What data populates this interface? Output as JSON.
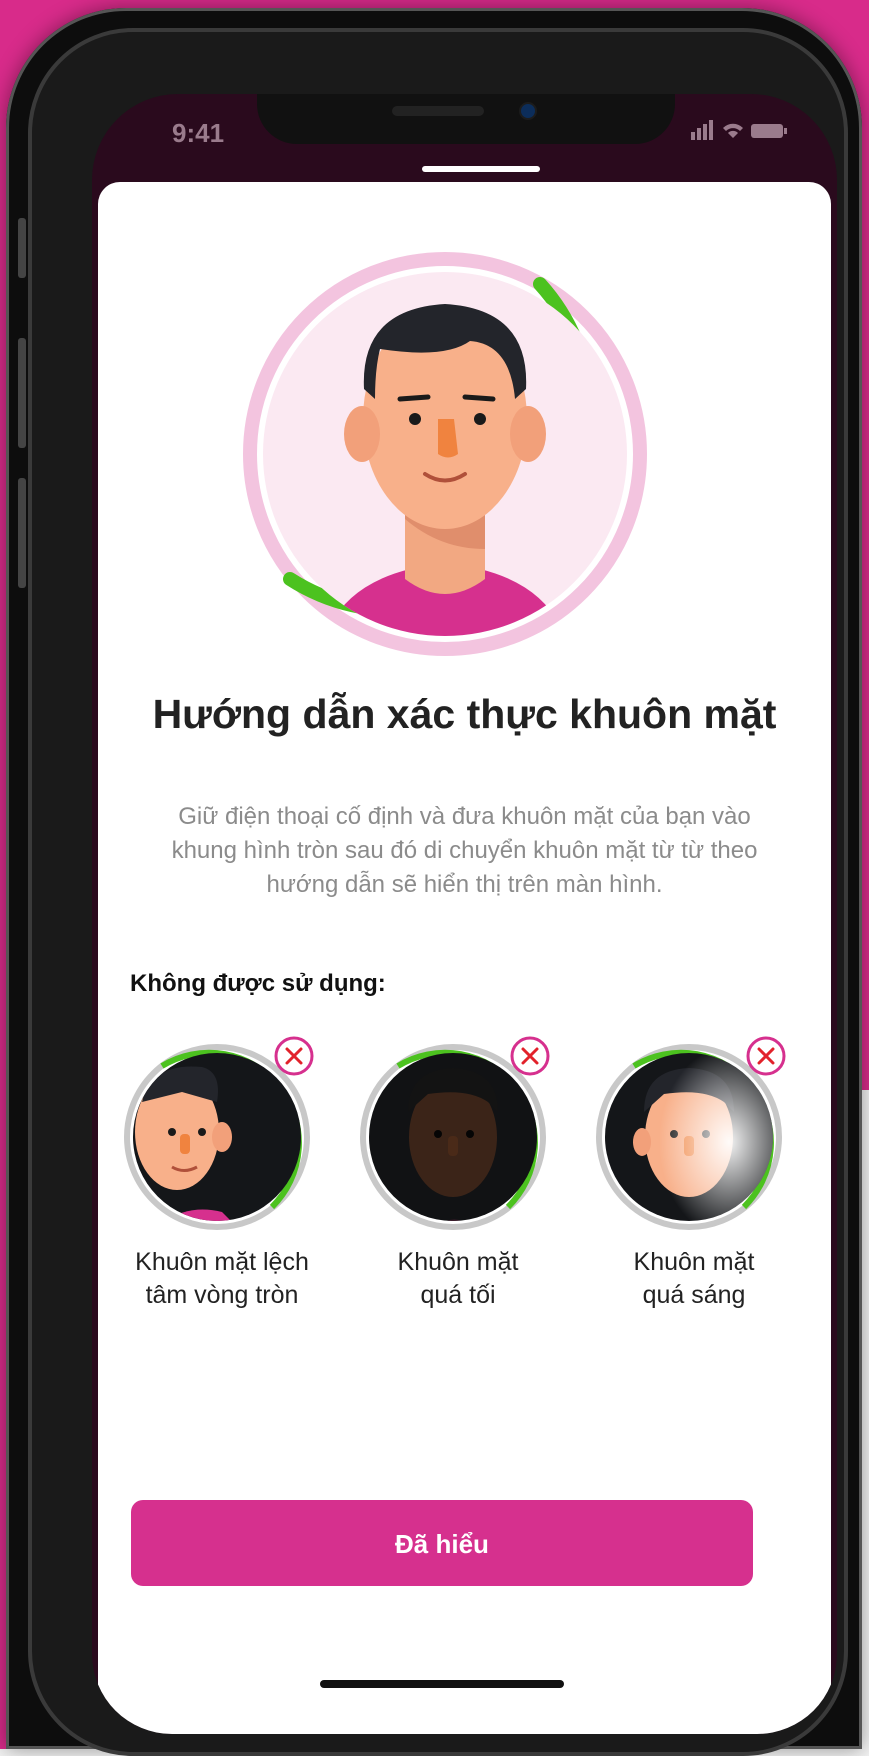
{
  "status_bar": {
    "time": "9:41",
    "signal_icons": "signal-wifi-battery-icons"
  },
  "page": {
    "title": "Hướng dẫn xác thực khuôn mặt",
    "description": "Giữ điện thoại cố định và đưa khuôn mặt của bạn vào khung hình tròn sau đó di chuyển khuôn mặt từ từ theo hướng dẫn sẽ hiển thị trên màn hình.",
    "not_allowed_label": "Không được sử dụng:"
  },
  "examples": [
    {
      "label_line1": "Khuôn mặt lệch",
      "label_line2": "tâm vòng tròn",
      "icon": "off-center-face-icon"
    },
    {
      "label_line1": "Khuôn mặt",
      "label_line2": "quá tối",
      "icon": "dark-face-icon"
    },
    {
      "label_line1": "Khuôn mặt",
      "label_line2": "quá sáng",
      "icon": "bright-face-icon"
    }
  ],
  "button": {
    "label": "Đã hiểu"
  },
  "colors": {
    "brand": "#d6308e",
    "success_ring": "#4cc21f",
    "ring_light": "#f3c4df"
  }
}
